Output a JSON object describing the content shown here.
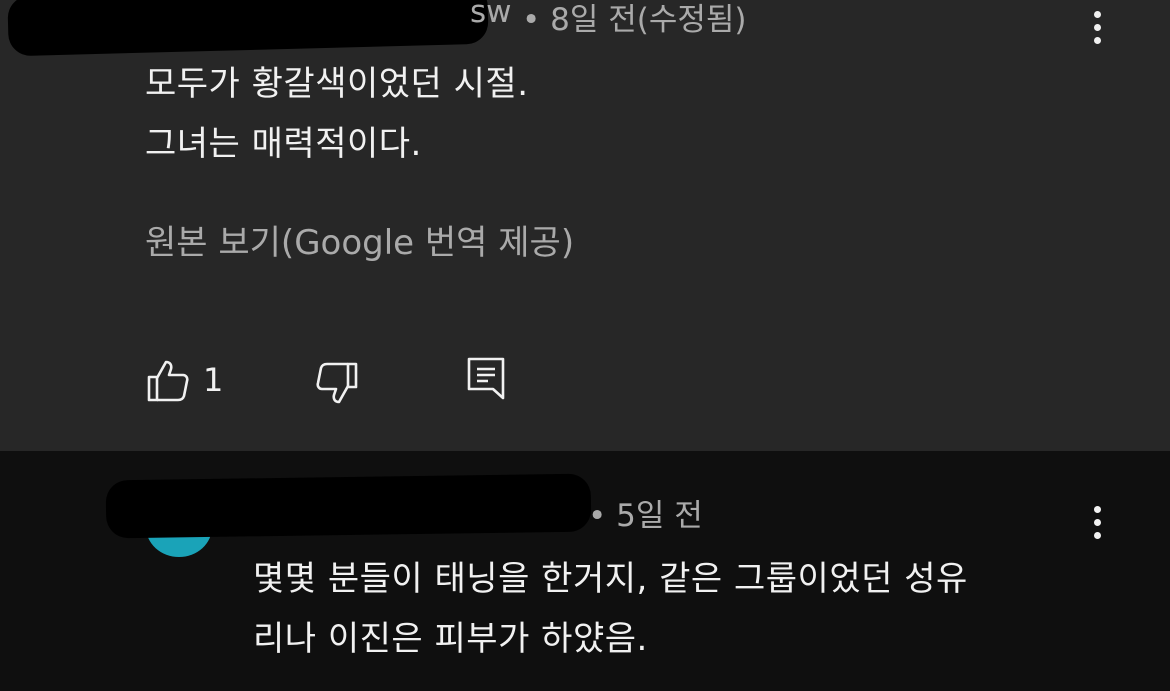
{
  "colors": {
    "top_bg": "#272727",
    "bottom_bg": "#0f0f0f",
    "text_primary": "#f1f1f1",
    "text_secondary": "#aaaaaa",
    "avatar_teal": "#1aa3b8"
  },
  "comment1": {
    "author_fragment": "sw",
    "time": "• 8일 전(수정됨)",
    "lines": [
      "모두가 황갈색이었던 시절.",
      "그녀는 매력적이다."
    ],
    "translate_label": "원본 보기(Google 번역 제공)",
    "like_count": "1",
    "icons": {
      "like": "thumbs-up-icon",
      "dislike": "thumbs-down-icon",
      "reply": "reply-icon",
      "menu": "more-vert-icon"
    }
  },
  "comment2": {
    "time": "• 5일 전",
    "lines": [
      "몇몇 분들이 태닝을 한거지, 같은 그룹이었던 성유",
      "리나 이진은 피부가 하얐음."
    ],
    "icons": {
      "menu": "more-vert-icon"
    }
  }
}
